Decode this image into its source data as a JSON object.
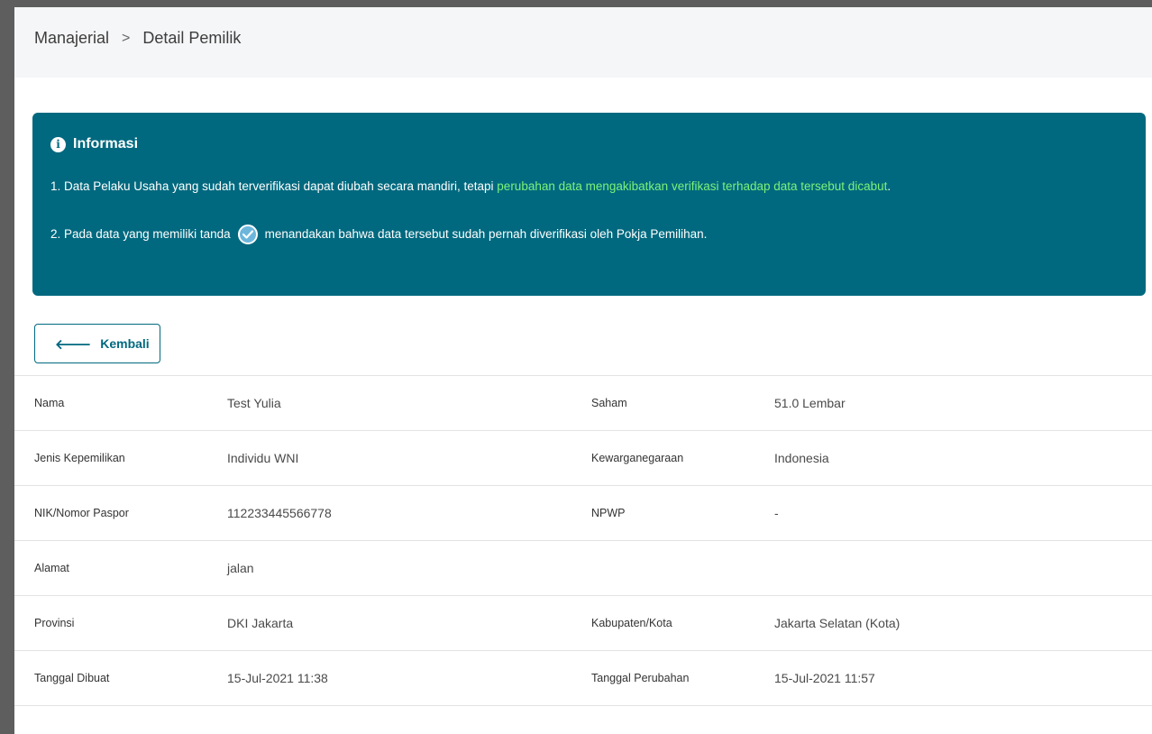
{
  "breadcrumb": {
    "parent": "Manajerial",
    "separator": ">",
    "current": "Detail Pemilik"
  },
  "info": {
    "title": "Informasi",
    "line1_prefix": "1. Data Pelaku Usaha yang sudah terverifikasi dapat diubah secara mandiri, tetapi ",
    "line1_highlight": "perubahan data mengakibatkan verifikasi terhadap data tersebut dicabut",
    "line1_suffix": ".",
    "line2_prefix": "2. Pada data yang memiliki tanda",
    "line2_suffix": "menandakan bahwa data tersebut sudah pernah diverifikasi oleh Pokja Pemilihan.",
    "icon": "info-circle-icon",
    "badge_icon": "check-circle-icon"
  },
  "back_button": {
    "label": "Kembali",
    "icon": "arrow-left-icon"
  },
  "details": {
    "rows": [
      {
        "label1": "Nama",
        "value1": "Test Yulia",
        "label2": "Saham",
        "value2": "51.0 Lembar"
      },
      {
        "label1": "Jenis Kepemilikan",
        "value1": "Individu WNI",
        "label2": "Kewarganegaraan",
        "value2": "Indonesia"
      },
      {
        "label1": "NIK/Nomor Paspor",
        "value1": "112233445566778",
        "label2": "NPWP",
        "value2": "-"
      },
      {
        "label1": "Alamat",
        "value1": "jalan",
        "label2": "",
        "value2": ""
      },
      {
        "label1": "Provinsi",
        "value1": "DKI Jakarta",
        "label2": "Kabupaten/Kota",
        "value2": "Jakarta Selatan (Kota)"
      },
      {
        "label1": "Tanggal Dibuat",
        "value1": "15-Jul-2021 11:38",
        "label2": "Tanggal Perubahan",
        "value2": "15-Jul-2021 11:57"
      }
    ]
  },
  "colors": {
    "info_bg": "#00697f",
    "highlight": "#7cf27a",
    "button_border": "#00697f"
  }
}
